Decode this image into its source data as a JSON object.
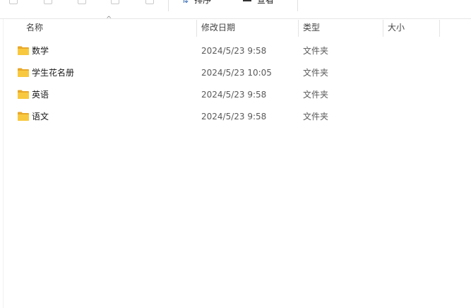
{
  "toolbar": {
    "sort_label": "排序",
    "view_label": "查看"
  },
  "columns": {
    "name": "名称",
    "date": "修改日期",
    "type": "类型",
    "size": "大小"
  },
  "rows": [
    {
      "name": "数学",
      "date": "2024/5/23 9:58",
      "type": "文件夹",
      "size": ""
    },
    {
      "name": "学生花名册",
      "date": "2024/5/23 10:05",
      "type": "文件夹",
      "size": ""
    },
    {
      "name": "英语",
      "date": "2024/5/23 9:58",
      "type": "文件夹",
      "size": ""
    },
    {
      "name": "语文",
      "date": "2024/5/23 9:58",
      "type": "文件夹",
      "size": ""
    }
  ],
  "colors": {
    "folder_fill": "#f8c93f",
    "folder_tab": "#e8a92a",
    "divider": "#e3e3e3"
  }
}
